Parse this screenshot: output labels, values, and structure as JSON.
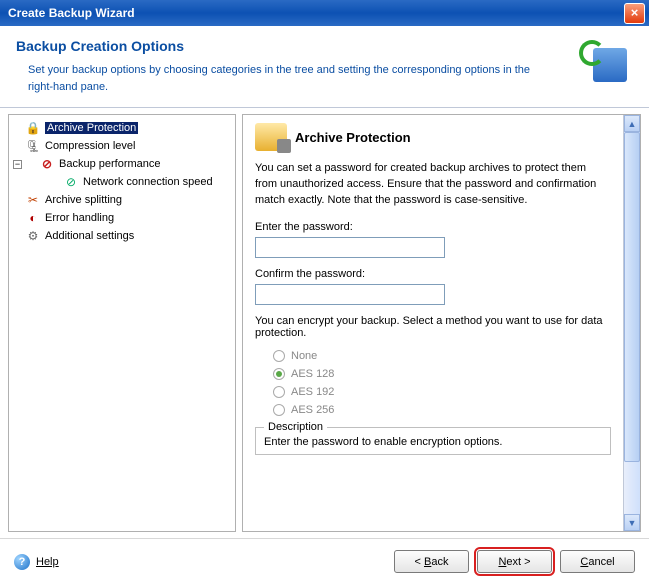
{
  "window": {
    "title": "Create Backup Wizard"
  },
  "header": {
    "title": "Backup Creation Options",
    "subtitle": "Set your backup options by choosing categories in the tree and setting the corresponding options in the right-hand pane."
  },
  "tree": {
    "items": [
      {
        "label": "Archive Protection",
        "icon": "lock",
        "level": "root",
        "selected": true
      },
      {
        "label": "Compression level",
        "icon": "comp",
        "level": "root"
      },
      {
        "label": "Backup performance",
        "icon": "perf",
        "level": "root",
        "expanded": true
      },
      {
        "label": "Network connection speed",
        "icon": "net",
        "level": "grandchild"
      },
      {
        "label": "Archive splitting",
        "icon": "split",
        "level": "root"
      },
      {
        "label": "Error handling",
        "icon": "err",
        "level": "root"
      },
      {
        "label": "Additional settings",
        "icon": "set",
        "level": "root"
      }
    ]
  },
  "panel": {
    "title": "Archive Protection",
    "description": "You can set a password for created backup archives to protect them from unauthorized access. Ensure that the password and confirmation match exactly. Note that the password is case-sensitive.",
    "pwd_label": "Enter the password:",
    "pwd_confirm_label": "Confirm the password:",
    "enc_desc": "You can encrypt your backup. Select a method you want to use for data protection.",
    "options": {
      "none": "None",
      "aes128": "AES 128",
      "aes192": "AES 192",
      "aes256": "AES 256"
    },
    "selected_option": "aes128",
    "fieldset_title": "Description",
    "fieldset_text": "Enter the password to enable encryption options."
  },
  "footer": {
    "help": "Help",
    "back": "< Back",
    "next": "Next >",
    "cancel": "Cancel"
  }
}
